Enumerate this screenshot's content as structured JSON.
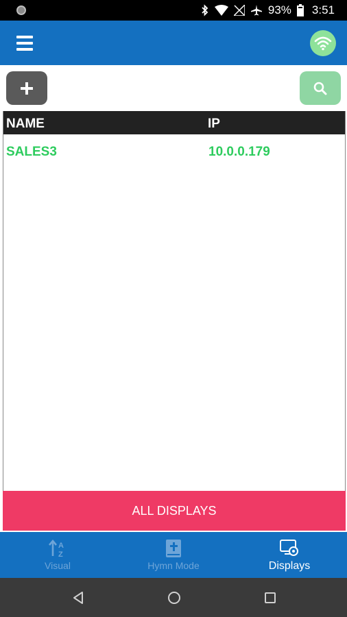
{
  "status_bar": {
    "battery": "93%",
    "time": "3:51"
  },
  "app_bar": {
    "menu_icon": "hamburger-icon",
    "wifi_icon": "wifi-icon"
  },
  "toolbar": {
    "add_icon": "plus-icon",
    "search_icon": "search-icon"
  },
  "table": {
    "headers": [
      "NAME",
      "IP"
    ],
    "rows": [
      {
        "name": "SALES3",
        "ip": "10.0.0.179"
      }
    ]
  },
  "all_displays_label": "ALL DISPLAYS",
  "bottom_nav": {
    "items": [
      {
        "label": "Visual",
        "icon": "sort-az-icon",
        "active": false
      },
      {
        "label": "Hymn Mode",
        "icon": "bible-icon",
        "active": false
      },
      {
        "label": "Displays",
        "icon": "display-settings-icon",
        "active": true
      }
    ]
  },
  "colors": {
    "primary": "#1470c0",
    "accent_green": "#2ecc5e",
    "button_pink": "#ef3a65"
  }
}
